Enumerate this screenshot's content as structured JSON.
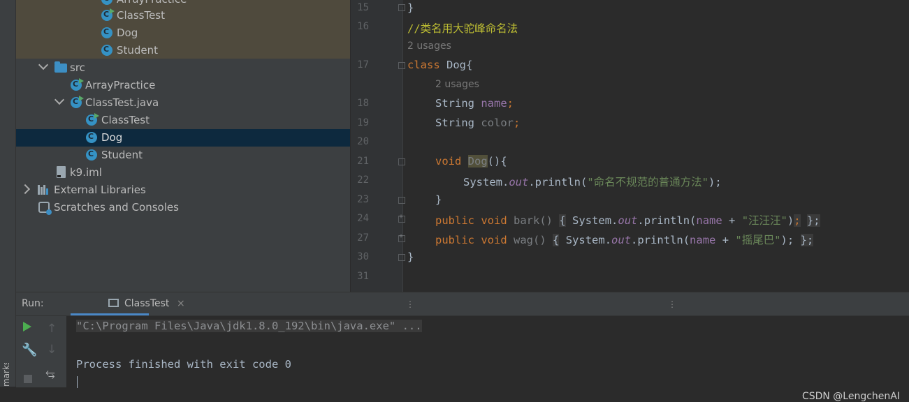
{
  "left_strip": {
    "bookmarks_label": "marks"
  },
  "project_tree": {
    "items": [
      {
        "label": "ArrayPractice"
      },
      {
        "label": "ClassTest"
      },
      {
        "label": "Dog"
      },
      {
        "label": "Student"
      },
      {
        "label": "src"
      },
      {
        "label": "ArrayPractice"
      },
      {
        "label": "ClassTest.java"
      },
      {
        "label": "ClassTest"
      },
      {
        "label": "Dog"
      },
      {
        "label": "Student"
      },
      {
        "label": "k9.iml"
      },
      {
        "label": "External Libraries"
      },
      {
        "label": "Scratches and Consoles"
      }
    ]
  },
  "editor": {
    "line_numbers": [
      "15",
      "16",
      "17",
      "18",
      "19",
      "20",
      "21",
      "22",
      "23",
      "24",
      "27",
      "30",
      "31"
    ],
    "usage_hint": "2 usages",
    "code": {
      "l15": "}",
      "l16_comment": "//类名用大驼峰命名法",
      "l17_kw": "class",
      "l17_name": "Dog{",
      "l18_type": "String",
      "l18_field": "name",
      "l18_semi": ";",
      "l19_type": "String",
      "l19_field": "color",
      "l19_semi": ";",
      "l21_kw": "void",
      "l21_name": "Dog",
      "l21_rest": "(){",
      "l22_sys": "System.",
      "l22_out": "out",
      "l22_call": ".println(",
      "l22_str": "\"命名不规范的普通方法\"",
      "l22_end": ");",
      "l23": "}",
      "l24_kw1": "public",
      "l24_kw2": "void",
      "l24_name": "bark()",
      "l24_open": "{",
      "l24_sys": "System.",
      "l24_out": "out",
      "l24_call": ".println(",
      "l24_field": "name",
      "l24_plus": " + ",
      "l24_str": "\"汪汪汪\"",
      "l24_paren": ")",
      "l24_semi": ";",
      "l24_close": "};",
      "l27_kw1": "public",
      "l27_kw2": "void",
      "l27_name": "wag()",
      "l27_open": "{",
      "l27_sys": "System.",
      "l27_out": "out",
      "l27_call": ".println(",
      "l27_field": "name",
      "l27_plus": " + ",
      "l27_str": "\"摇尾巴\"",
      "l27_end": ");",
      "l27_close": "};",
      "l30": "}"
    }
  },
  "run_panel": {
    "label": "Run:",
    "tab_label": "ClassTest",
    "close_glyph": "×",
    "console_lines": [
      "\"C:\\Program Files\\Java\\jdk1.8.0_192\\bin\\java.exe\" ...",
      "Process finished with exit code 0"
    ],
    "watermark": "CSDN @LengchenAI"
  },
  "colors": {
    "keyword": "#cc7832",
    "field": "#9876aa",
    "string": "#6a8759",
    "comment": "#bcbc33",
    "selection": "#0d293e",
    "tab_accent": "#4a88c7"
  }
}
